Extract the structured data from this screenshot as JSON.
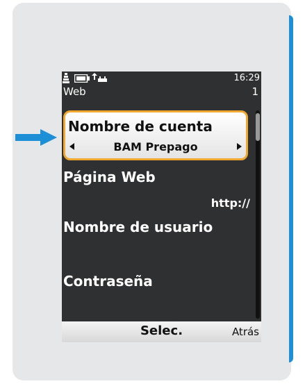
{
  "status_bar": {
    "time": "16:29",
    "icons": [
      "signal-icon",
      "battery-icon",
      "data-connection-icon"
    ]
  },
  "header": {
    "title": "Web",
    "page_indicator": "1"
  },
  "settings": [
    {
      "label": "Nombre de cuenta",
      "value": "BAM Prepago",
      "selected": true
    },
    {
      "label": "Página Web",
      "value": "http://"
    },
    {
      "label": "Nombre de usuario",
      "value": ""
    },
    {
      "label": "Contraseña",
      "value": ""
    }
  ],
  "softkeys": {
    "center": "Selec.",
    "right": "Atrás"
  },
  "colors": {
    "highlight_border": "#f0a830",
    "arrow": "#1d8fd6",
    "screen_bg": "#2f3031",
    "panel_bg": "#e6e7e9"
  }
}
